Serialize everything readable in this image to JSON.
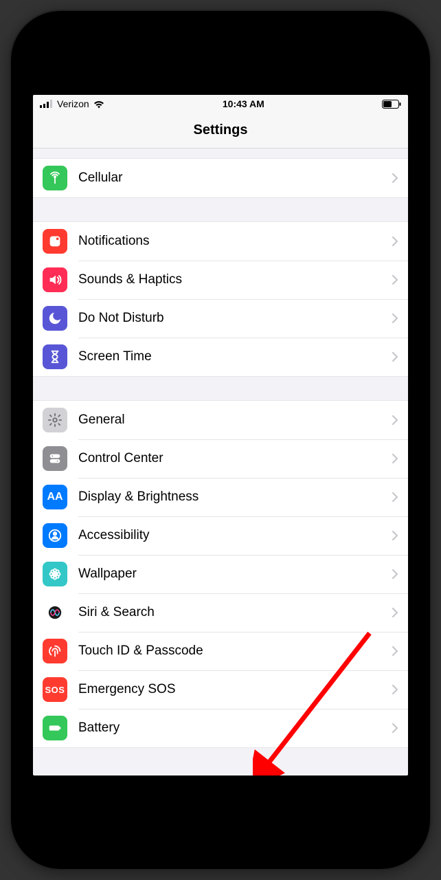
{
  "statusbar": {
    "carrier": "Verizon",
    "time": "10:43 AM"
  },
  "nav": {
    "title": "Settings"
  },
  "groups": [
    {
      "rows": [
        {
          "key": "cellular",
          "label": "Cellular",
          "icon": "antenna",
          "color": "#34c759"
        }
      ]
    },
    {
      "rows": [
        {
          "key": "notifications",
          "label": "Notifications",
          "icon": "bell",
          "color": "#ff3b30"
        },
        {
          "key": "sounds",
          "label": "Sounds & Haptics",
          "icon": "speaker",
          "color": "#ff2d55"
        },
        {
          "key": "dnd",
          "label": "Do Not Disturb",
          "icon": "moon",
          "color": "#5856d6"
        },
        {
          "key": "screentime",
          "label": "Screen Time",
          "icon": "hourglass",
          "color": "#5856d6"
        }
      ]
    },
    {
      "rows": [
        {
          "key": "general",
          "label": "General",
          "icon": "gear",
          "color": "#d1d1d6"
        },
        {
          "key": "controlcenter",
          "label": "Control Center",
          "icon": "toggles",
          "color": "#8e8e93"
        },
        {
          "key": "display",
          "label": "Display & Brightness",
          "icon": "aa",
          "color": "#007aff"
        },
        {
          "key": "accessibility",
          "label": "Accessibility",
          "icon": "person",
          "color": "#007aff"
        },
        {
          "key": "wallpaper",
          "label": "Wallpaper",
          "icon": "flower",
          "color": "#33c7c7"
        },
        {
          "key": "siri",
          "label": "Siri & Search",
          "icon": "siri",
          "color": "#1a1a1a"
        },
        {
          "key": "touchid",
          "label": "Touch ID & Passcode",
          "icon": "fingerprint",
          "color": "#ff3b30"
        },
        {
          "key": "sos",
          "label": "Emergency SOS",
          "icon": "sos",
          "color": "#ff3b30"
        },
        {
          "key": "battery",
          "label": "Battery",
          "icon": "battery",
          "color": "#34c759"
        }
      ]
    }
  ]
}
